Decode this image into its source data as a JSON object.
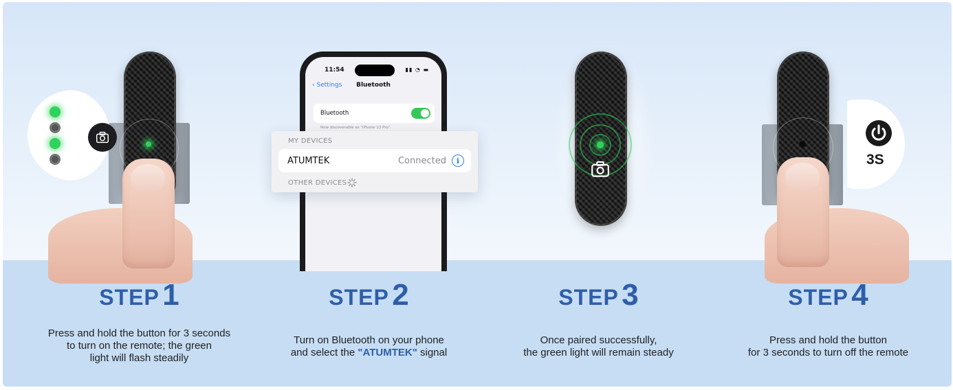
{
  "colors": {
    "accent_blue": "#2f5ea9",
    "indicator_green": "#2fd35b",
    "band_blue": "#c6ddf4"
  },
  "step1": {
    "icons": [
      "camera-icon"
    ]
  },
  "phone": {
    "time": "11:54",
    "back_label": "Settings",
    "title": "Bluetooth",
    "bluetooth_label": "Bluetooth",
    "discoverable_note": "Now discoverable as \"iPhone 13 Pro\".",
    "my_devices_header": "MY DEVICES",
    "device_name": "ATUMTEK",
    "device_status": "Connected",
    "other_devices_header": "OTHER DEVICES"
  },
  "step4": {
    "power_label": "3S"
  },
  "steps": [
    {
      "word": "STEP",
      "number": "1",
      "description_lines": [
        "Press and hold the button for 3 seconds",
        "to turn on the remote; the green",
        "light will flash steadily"
      ]
    },
    {
      "word": "STEP",
      "number": "2",
      "line1": "Turn on Bluetooth on your phone",
      "line2_prefix": "and select the ",
      "line2_highlight": "\"ATUMTEK\"",
      "line2_suffix": " signal"
    },
    {
      "word": "STEP",
      "number": "3",
      "description_lines": [
        "Once paired successfully,",
        "the green light will remain steady"
      ]
    },
    {
      "word": "STEP",
      "number": "4",
      "description_lines": [
        "Press and hold the button",
        "for 3 seconds to turn off the remote"
      ]
    }
  ]
}
